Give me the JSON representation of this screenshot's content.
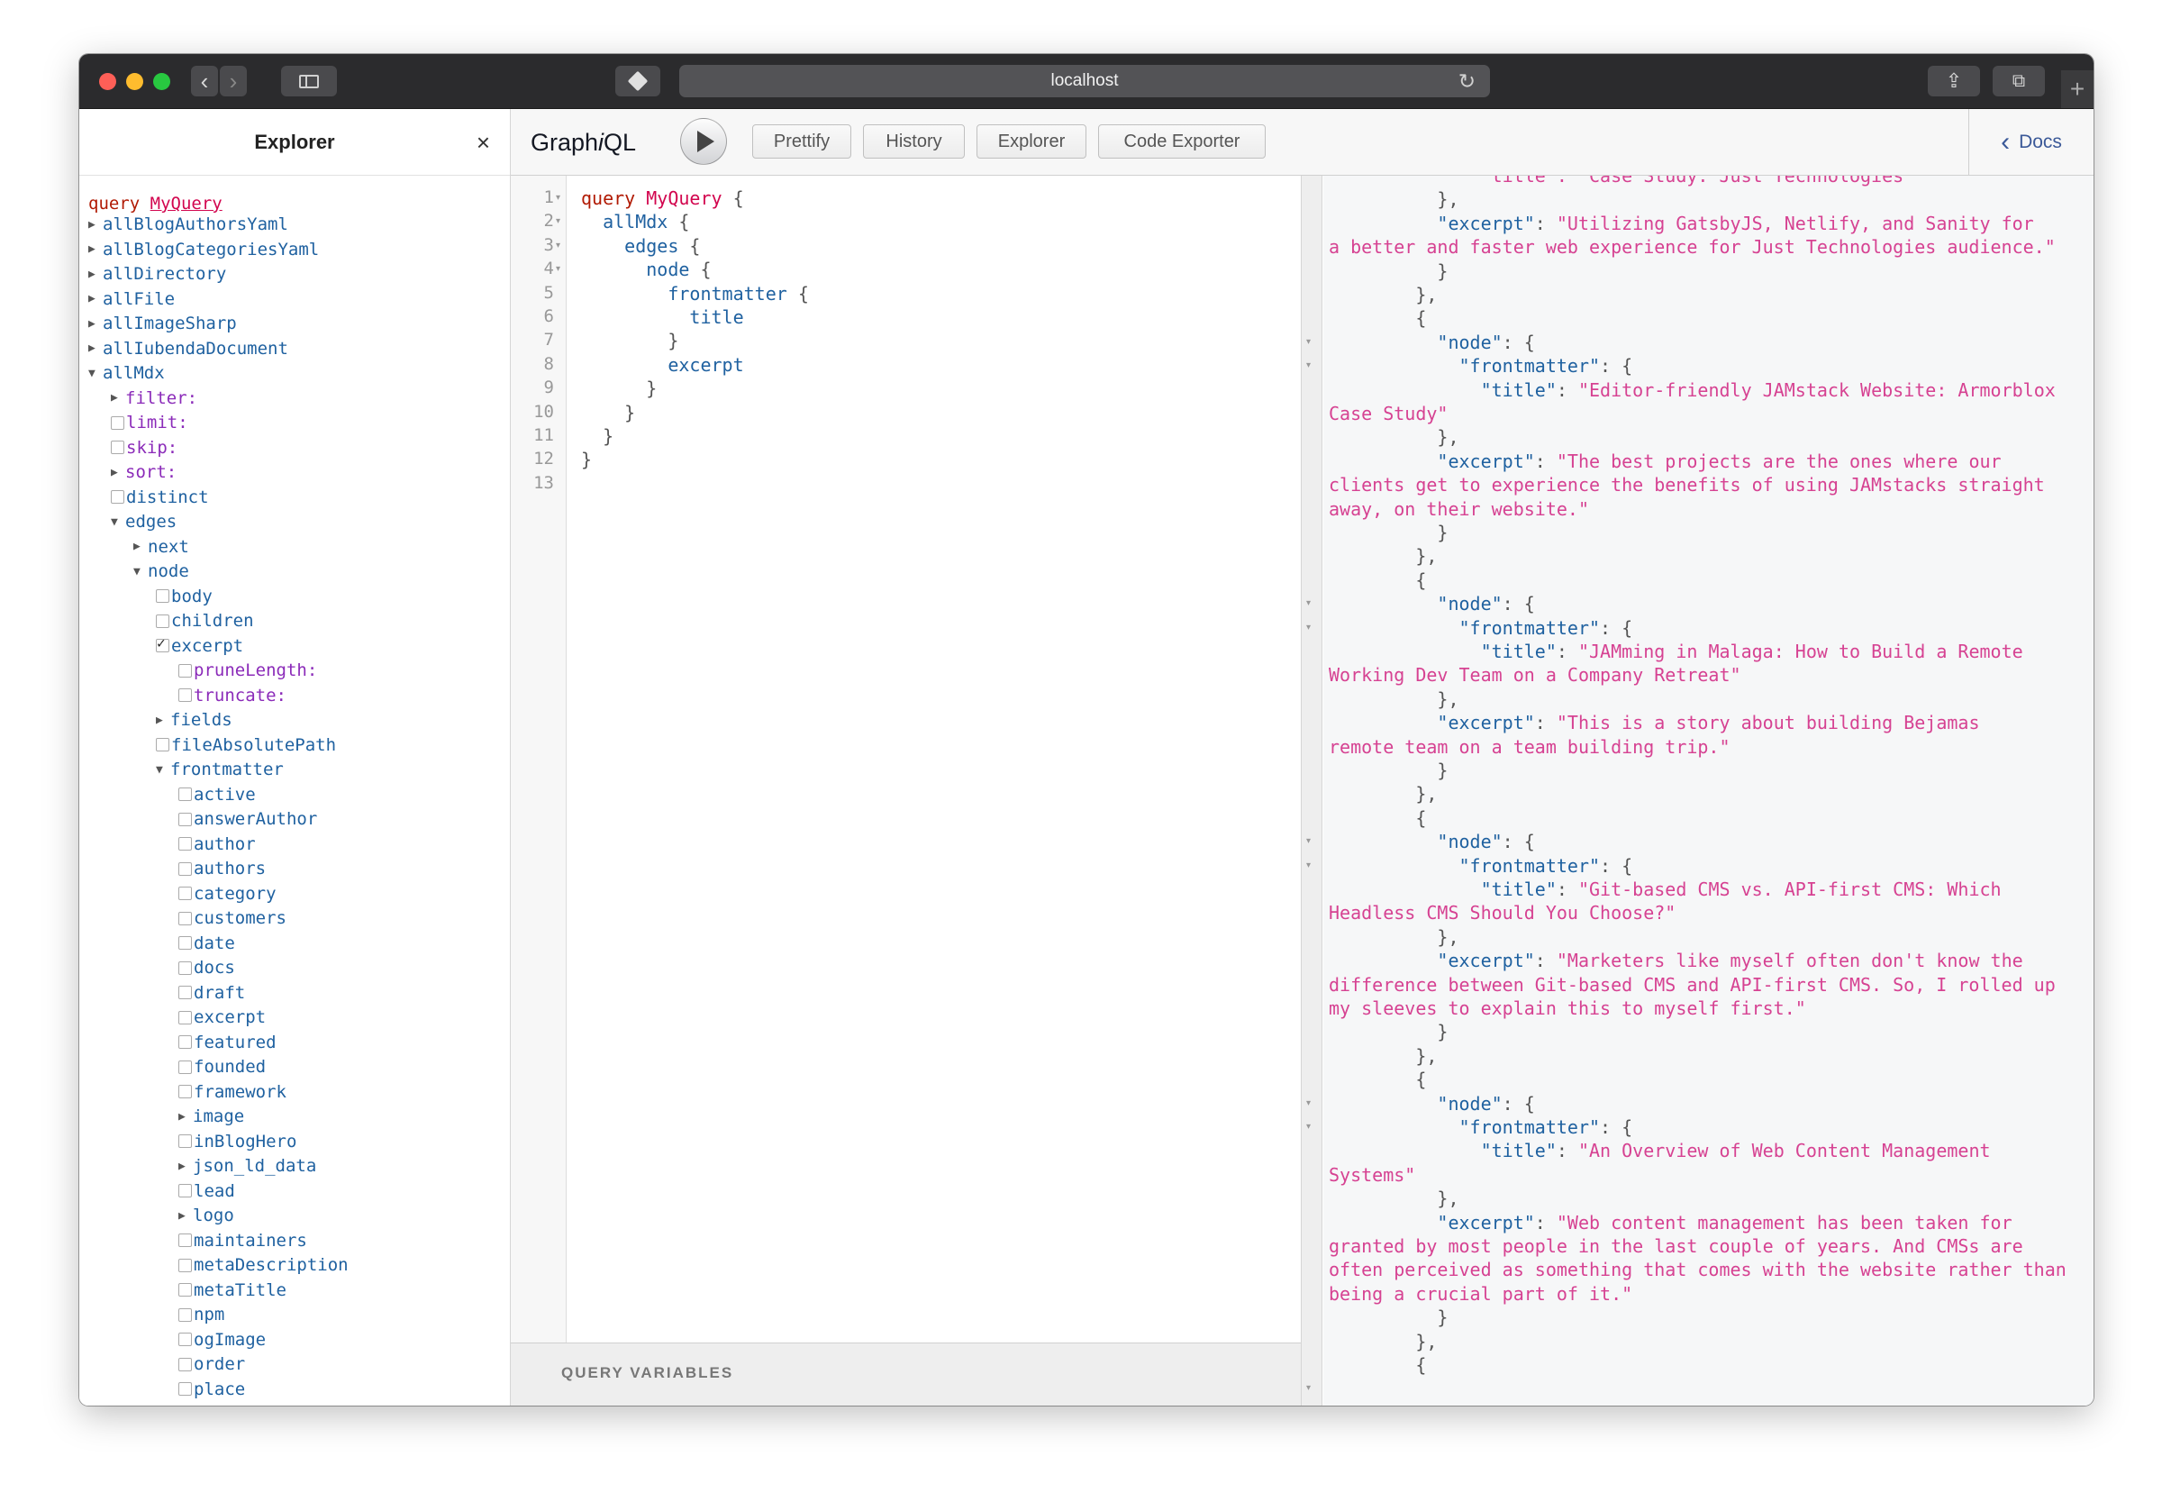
{
  "browser": {
    "url": "localhost"
  },
  "explorer": {
    "title": "Explorer",
    "close": "×",
    "query_keyword": "query",
    "query_name": "MyQuery",
    "tree": [
      {
        "label": "allBlogAuthorsYaml",
        "kind": "arrow-right",
        "indent": 0
      },
      {
        "label": "allBlogCategoriesYaml",
        "kind": "arrow-right",
        "indent": 0
      },
      {
        "label": "allDirectory",
        "kind": "arrow-right",
        "indent": 0
      },
      {
        "label": "allFile",
        "kind": "arrow-right",
        "indent": 0
      },
      {
        "label": "allImageSharp",
        "kind": "arrow-right",
        "indent": 0
      },
      {
        "label": "allIubendaDocument",
        "kind": "arrow-right",
        "indent": 0
      },
      {
        "label": "allMdx",
        "kind": "arrow-down",
        "indent": 0
      },
      {
        "label": "filter:",
        "kind": "arrow-right",
        "indent": 1,
        "arg": true
      },
      {
        "label": "limit:",
        "kind": "checkbox",
        "indent": 1,
        "arg": true
      },
      {
        "label": "skip:",
        "kind": "checkbox",
        "indent": 1,
        "arg": true
      },
      {
        "label": "sort:",
        "kind": "arrow-right",
        "indent": 1,
        "arg": true
      },
      {
        "label": "distinct",
        "kind": "checkbox",
        "indent": 1
      },
      {
        "label": "edges",
        "kind": "arrow-down",
        "indent": 1
      },
      {
        "label": "next",
        "kind": "arrow-right",
        "indent": 2
      },
      {
        "label": "node",
        "kind": "arrow-down",
        "indent": 2
      },
      {
        "label": "body",
        "kind": "checkbox",
        "indent": 3
      },
      {
        "label": "children",
        "kind": "checkbox",
        "indent": 3
      },
      {
        "label": "excerpt",
        "kind": "checked",
        "indent": 3
      },
      {
        "label": "pruneLength:",
        "kind": "checkbox",
        "indent": 4,
        "arg": true
      },
      {
        "label": "truncate:",
        "kind": "checkbox",
        "indent": 4,
        "arg": true
      },
      {
        "label": "fields",
        "kind": "arrow-right",
        "indent": 3
      },
      {
        "label": "fileAbsolutePath",
        "kind": "checkbox",
        "indent": 3
      },
      {
        "label": "frontmatter",
        "kind": "arrow-down",
        "indent": 3
      },
      {
        "label": "active",
        "kind": "checkbox",
        "indent": 4
      },
      {
        "label": "answerAuthor",
        "kind": "checkbox",
        "indent": 4
      },
      {
        "label": "author",
        "kind": "checkbox",
        "indent": 4
      },
      {
        "label": "authors",
        "kind": "checkbox",
        "indent": 4
      },
      {
        "label": "category",
        "kind": "checkbox",
        "indent": 4
      },
      {
        "label": "customers",
        "kind": "checkbox",
        "indent": 4
      },
      {
        "label": "date",
        "kind": "checkbox",
        "indent": 4
      },
      {
        "label": "docs",
        "kind": "checkbox",
        "indent": 4
      },
      {
        "label": "draft",
        "kind": "checkbox",
        "indent": 4
      },
      {
        "label": "excerpt",
        "kind": "checkbox",
        "indent": 4
      },
      {
        "label": "featured",
        "kind": "checkbox",
        "indent": 4
      },
      {
        "label": "founded",
        "kind": "checkbox",
        "indent": 4
      },
      {
        "label": "framework",
        "kind": "checkbox",
        "indent": 4
      },
      {
        "label": "image",
        "kind": "arrow-right",
        "indent": 4
      },
      {
        "label": "inBlogHero",
        "kind": "checkbox",
        "indent": 4
      },
      {
        "label": "json_ld_data",
        "kind": "arrow-right",
        "indent": 4
      },
      {
        "label": "lead",
        "kind": "checkbox",
        "indent": 4
      },
      {
        "label": "logo",
        "kind": "arrow-right",
        "indent": 4
      },
      {
        "label": "maintainers",
        "kind": "checkbox",
        "indent": 4
      },
      {
        "label": "metaDescription",
        "kind": "checkbox",
        "indent": 4
      },
      {
        "label": "metaTitle",
        "kind": "checkbox",
        "indent": 4
      },
      {
        "label": "npm",
        "kind": "checkbox",
        "indent": 4
      },
      {
        "label": "ogImage",
        "kind": "checkbox",
        "indent": 4
      },
      {
        "label": "order",
        "kind": "checkbox",
        "indent": 4
      },
      {
        "label": "place",
        "kind": "checkbox",
        "indent": 4
      }
    ]
  },
  "toolbar": {
    "title_prefix": "Graph",
    "title_italic": "i",
    "title_suffix": "QL",
    "prettify": "Prettify",
    "history": "History",
    "explorer": "Explorer",
    "code_exporter": "Code Exporter",
    "docs": "Docs"
  },
  "editor": {
    "lines": [
      {
        "n": "1",
        "fold": true,
        "segs": [
          [
            "kw",
            "query"
          ],
          [
            "plain",
            " "
          ],
          [
            "def",
            "MyQuery"
          ],
          [
            "plain",
            " {"
          ]
        ]
      },
      {
        "n": "2",
        "fold": true,
        "segs": [
          [
            "plain",
            "  "
          ],
          [
            "field",
            "allMdx"
          ],
          [
            "plain",
            " {"
          ]
        ]
      },
      {
        "n": "3",
        "fold": true,
        "segs": [
          [
            "plain",
            "    "
          ],
          [
            "field",
            "edges"
          ],
          [
            "plain",
            " {"
          ]
        ]
      },
      {
        "n": "4",
        "fold": true,
        "segs": [
          [
            "plain",
            "      "
          ],
          [
            "field",
            "node"
          ],
          [
            "plain",
            " {"
          ]
        ]
      },
      {
        "n": "5",
        "fold": false,
        "segs": [
          [
            "plain",
            "        "
          ],
          [
            "field",
            "frontmatter"
          ],
          [
            "plain",
            " {"
          ]
        ]
      },
      {
        "n": "6",
        "fold": false,
        "segs": [
          [
            "plain",
            "          "
          ],
          [
            "field",
            "title"
          ]
        ]
      },
      {
        "n": "7",
        "fold": false,
        "segs": [
          [
            "plain",
            "        }"
          ]
        ]
      },
      {
        "n": "8",
        "fold": false,
        "segs": [
          [
            "plain",
            "        "
          ],
          [
            "field",
            "excerpt"
          ]
        ]
      },
      {
        "n": "9",
        "fold": false,
        "segs": [
          [
            "plain",
            "      }"
          ]
        ]
      },
      {
        "n": "10",
        "fold": false,
        "segs": [
          [
            "plain",
            "    }"
          ]
        ]
      },
      {
        "n": "11",
        "fold": false,
        "segs": [
          [
            "plain",
            "  }"
          ]
        ]
      },
      {
        "n": "12",
        "fold": false,
        "segs": [
          [
            "plain",
            "}"
          ]
        ]
      },
      {
        "n": "13",
        "fold": false,
        "segs": []
      }
    ],
    "query_variables_label": "QUERY VARIABLES"
  },
  "result": {
    "lines": [
      [
        [
          "plain",
          "              "
        ],
        [
          "str",
          "\"title\": \"Case Study: Just Technologies\""
        ]
      ],
      [
        [
          "plain",
          "          },"
        ]
      ],
      [
        [
          "plain",
          "          "
        ],
        [
          "key",
          "\"excerpt\""
        ],
        [
          "plain",
          ": "
        ],
        [
          "str",
          "\"Utilizing GatsbyJS, Netlify, and Sanity for"
        ]
      ],
      [
        [
          "str",
          "a better and faster web experience for Just Technologies audience.\""
        ]
      ],
      [
        [
          "plain",
          "          }"
        ]
      ],
      [
        [
          "plain",
          "        },"
        ]
      ],
      [
        [
          "plain",
          "        {"
        ]
      ],
      [
        [
          "plain",
          "          "
        ],
        [
          "key",
          "\"node\""
        ],
        [
          "plain",
          ": {"
        ]
      ],
      [
        [
          "plain",
          "            "
        ],
        [
          "key",
          "\"frontmatter\""
        ],
        [
          "plain",
          ": {"
        ]
      ],
      [
        [
          "plain",
          "              "
        ],
        [
          "key",
          "\"title\""
        ],
        [
          "plain",
          ": "
        ],
        [
          "str",
          "\"Editor-friendly JAMstack Website: Armorblox"
        ]
      ],
      [
        [
          "str",
          "Case Study\""
        ]
      ],
      [
        [
          "plain",
          "          },"
        ]
      ],
      [
        [
          "plain",
          "          "
        ],
        [
          "key",
          "\"excerpt\""
        ],
        [
          "plain",
          ": "
        ],
        [
          "str",
          "\"The best projects are the ones where our"
        ]
      ],
      [
        [
          "str",
          "clients get to experience the benefits of using JAMstacks straight"
        ]
      ],
      [
        [
          "str",
          "away, on their website.\""
        ]
      ],
      [
        [
          "plain",
          "          }"
        ]
      ],
      [
        [
          "plain",
          "        },"
        ]
      ],
      [
        [
          "plain",
          "        {"
        ]
      ],
      [
        [
          "plain",
          "          "
        ],
        [
          "key",
          "\"node\""
        ],
        [
          "plain",
          ": {"
        ]
      ],
      [
        [
          "plain",
          "            "
        ],
        [
          "key",
          "\"frontmatter\""
        ],
        [
          "plain",
          ": {"
        ]
      ],
      [
        [
          "plain",
          "              "
        ],
        [
          "key",
          "\"title\""
        ],
        [
          "plain",
          ": "
        ],
        [
          "str",
          "\"JAMming in Malaga: How to Build a Remote"
        ]
      ],
      [
        [
          "str",
          "Working Dev Team on a Company Retreat\""
        ]
      ],
      [
        [
          "plain",
          "          },"
        ]
      ],
      [
        [
          "plain",
          "          "
        ],
        [
          "key",
          "\"excerpt\""
        ],
        [
          "plain",
          ": "
        ],
        [
          "str",
          "\"This is a story about building Bejamas"
        ]
      ],
      [
        [
          "str",
          "remote team on a team building trip.\""
        ]
      ],
      [
        [
          "plain",
          "          }"
        ]
      ],
      [
        [
          "plain",
          "        },"
        ]
      ],
      [
        [
          "plain",
          "        {"
        ]
      ],
      [
        [
          "plain",
          "          "
        ],
        [
          "key",
          "\"node\""
        ],
        [
          "plain",
          ": {"
        ]
      ],
      [
        [
          "plain",
          "            "
        ],
        [
          "key",
          "\"frontmatter\""
        ],
        [
          "plain",
          ": {"
        ]
      ],
      [
        [
          "plain",
          "              "
        ],
        [
          "key",
          "\"title\""
        ],
        [
          "plain",
          ": "
        ],
        [
          "str",
          "\"Git-based CMS vs. API-first CMS: Which"
        ]
      ],
      [
        [
          "str",
          "Headless CMS Should You Choose?\""
        ]
      ],
      [
        [
          "plain",
          "          },"
        ]
      ],
      [
        [
          "plain",
          "          "
        ],
        [
          "key",
          "\"excerpt\""
        ],
        [
          "plain",
          ": "
        ],
        [
          "str",
          "\"Marketers like myself often don't know the"
        ]
      ],
      [
        [
          "str",
          "difference between Git-based CMS and API-first CMS. So, I rolled up"
        ]
      ],
      [
        [
          "str",
          "my sleeves to explain this to myself first.\""
        ]
      ],
      [
        [
          "plain",
          "          }"
        ]
      ],
      [
        [
          "plain",
          "        },"
        ]
      ],
      [
        [
          "plain",
          "        {"
        ]
      ],
      [
        [
          "plain",
          "          "
        ],
        [
          "key",
          "\"node\""
        ],
        [
          "plain",
          ": {"
        ]
      ],
      [
        [
          "plain",
          "            "
        ],
        [
          "key",
          "\"frontmatter\""
        ],
        [
          "plain",
          ": {"
        ]
      ],
      [
        [
          "plain",
          "              "
        ],
        [
          "key",
          "\"title\""
        ],
        [
          "plain",
          ": "
        ],
        [
          "str",
          "\"An Overview of Web Content Management"
        ]
      ],
      [
        [
          "str",
          "Systems\""
        ]
      ],
      [
        [
          "plain",
          "          },"
        ]
      ],
      [
        [
          "plain",
          "          "
        ],
        [
          "key",
          "\"excerpt\""
        ],
        [
          "plain",
          ": "
        ],
        [
          "str",
          "\"Web content management has been taken for"
        ]
      ],
      [
        [
          "str",
          "granted by most people in the last couple of years. And CMSs are"
        ]
      ],
      [
        [
          "str",
          "often perceived as something that comes with the website rather than"
        ]
      ],
      [
        [
          "str",
          "being a crucial part of it.\""
        ]
      ],
      [
        [
          "plain",
          "          }"
        ]
      ],
      [
        [
          "plain",
          "        },"
        ]
      ],
      [
        [
          "plain",
          "        {"
        ]
      ]
    ]
  },
  "colors": {
    "field": "#1f61a0",
    "keyword": "#b11a04",
    "def": "#d2054e",
    "string": "#d64292",
    "arg": "#8b2bb9"
  }
}
